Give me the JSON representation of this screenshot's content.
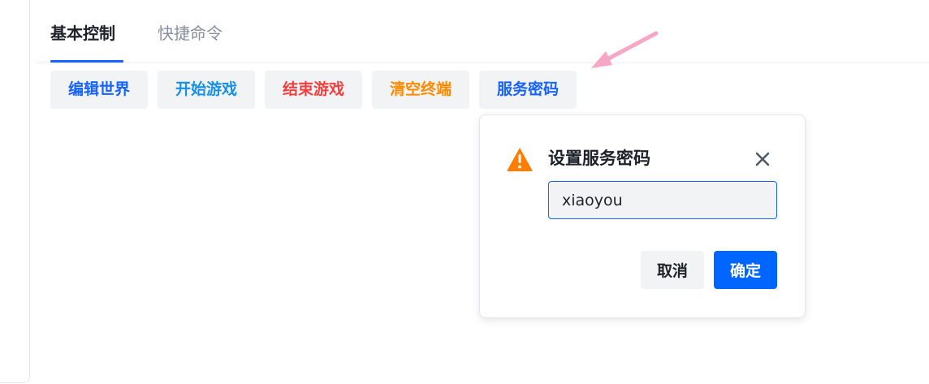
{
  "tabs": [
    {
      "label": "基本控制",
      "active": true
    },
    {
      "label": "快捷命令",
      "active": false
    }
  ],
  "actions": [
    {
      "label": "编辑世界",
      "color": "#1663ff"
    },
    {
      "label": "开始游戏",
      "color": "#1890e8"
    },
    {
      "label": "结束游戏",
      "color": "#f53f3f"
    },
    {
      "label": "清空终端",
      "color": "#ff8a00"
    },
    {
      "label": "服务密码",
      "color": "#1663ff"
    }
  ],
  "dialog": {
    "title": "设置服务密码",
    "icon": "warning-icon",
    "icon_color": "#ff7d00",
    "input_value": "xiaoyou",
    "cancel_label": "取消",
    "confirm_label": "确定"
  },
  "annotation": {
    "icon": "pink-arrow-icon",
    "color": "#f7a6c6"
  },
  "colors": {
    "primary": "#1663ff",
    "confirm": "#0066ff",
    "button_bg": "#f2f3f5"
  }
}
